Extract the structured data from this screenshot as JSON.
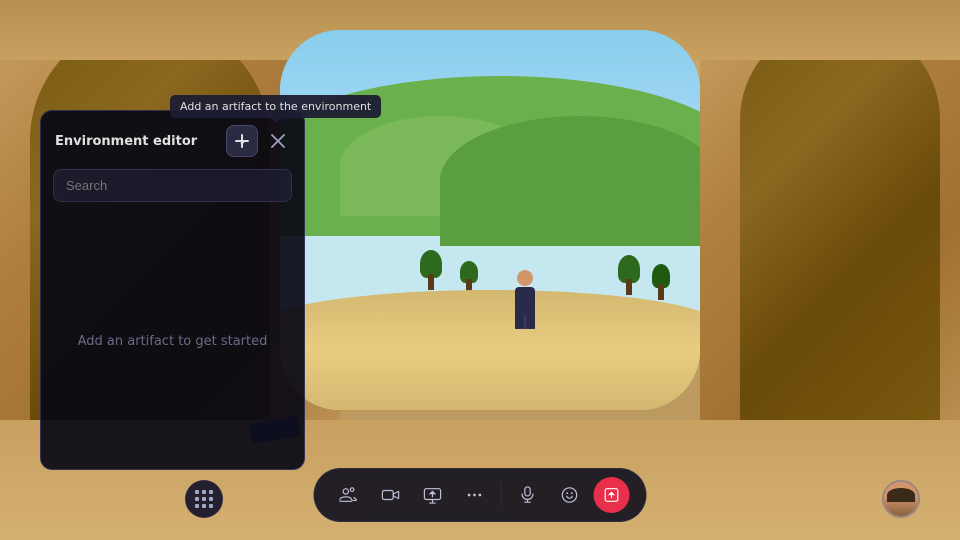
{
  "environment": {
    "bg_color": "#c8a870"
  },
  "panel": {
    "title": "Environment editor",
    "search_placeholder": "Search",
    "empty_message": "Add an artifact to get started",
    "add_button_label": "+",
    "close_button_label": "×",
    "tooltip": "Add an artifact to the environment"
  },
  "toolbar": {
    "buttons": [
      {
        "id": "people",
        "label": "People",
        "icon": "people"
      },
      {
        "id": "video",
        "label": "Video",
        "icon": "video"
      },
      {
        "id": "screen",
        "label": "Screen share",
        "icon": "screen"
      },
      {
        "id": "more",
        "label": "More",
        "icon": "more"
      },
      {
        "id": "mic",
        "label": "Microphone",
        "icon": "mic"
      },
      {
        "id": "emoji",
        "label": "Emoji",
        "icon": "emoji"
      },
      {
        "id": "share",
        "label": "Share",
        "icon": "share",
        "active": true
      }
    ],
    "apps_label": "Apps",
    "avatar_label": "Avatar"
  }
}
